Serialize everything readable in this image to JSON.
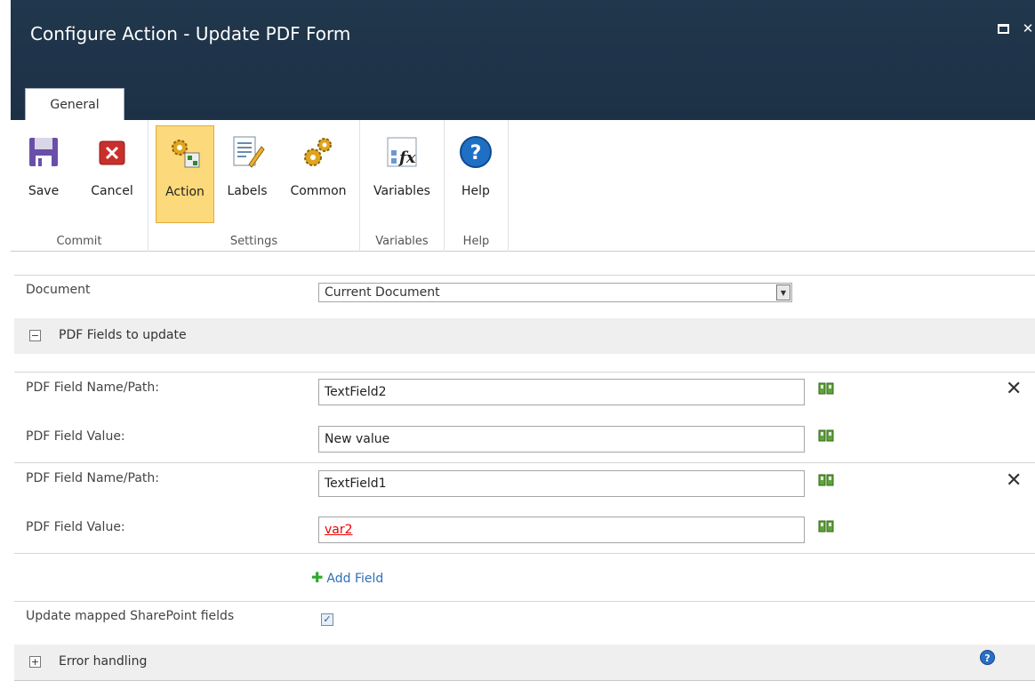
{
  "window": {
    "title": "Configure Action - Update PDF Form"
  },
  "tabs": [
    {
      "label": "General"
    }
  ],
  "ribbon": {
    "buttons": {
      "save": "Save",
      "cancel": "Cancel",
      "action": "Action",
      "labels": "Labels",
      "common": "Common",
      "variables": "Variables",
      "help": "Help"
    },
    "groups": {
      "commit": "Commit",
      "settings": "Settings",
      "variables": "Variables",
      "help": "Help"
    }
  },
  "form": {
    "document": {
      "label": "Document",
      "value": "Current Document"
    },
    "pdf_section": {
      "title": "PDF Fields to update",
      "expanded": true
    },
    "fields": [
      {
        "name_label": "PDF Field Name/Path:",
        "name_value": "TextField2",
        "value_label": "PDF Field Value:",
        "value_value": "New value"
      },
      {
        "name_label": "PDF Field Name/Path:",
        "name_value": "TextField1",
        "value_label": "PDF Field Value:",
        "value_value": "var2"
      }
    ],
    "add_field": "Add Field",
    "update_mapped": {
      "label": "Update mapped SharePoint fields",
      "checked": true
    },
    "error_section": {
      "title": "Error handling",
      "expanded": false
    }
  },
  "colors": {
    "titlebar": "#1c3046",
    "active_button": "#fcd97a",
    "link": "#2f6fb8",
    "variable_token": "#e00000"
  },
  "icons": [
    "maximize-icon",
    "close-icon",
    "save-icon",
    "cancel-icon",
    "action-gears-icon",
    "labels-icon",
    "common-gears-icon",
    "variables-icon",
    "help-icon",
    "lookup-book-icon",
    "remove-x-icon",
    "add-plus-icon",
    "help-circle-icon"
  ]
}
